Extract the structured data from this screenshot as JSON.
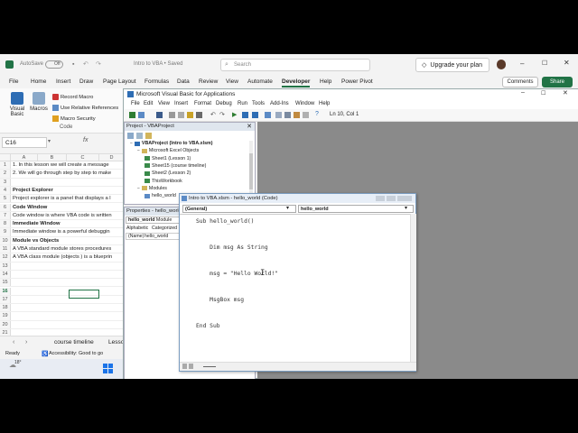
{
  "excel": {
    "autosave_label": "AutoSave",
    "autosave_state": "Off",
    "doc_title": "Intro to VBA • Saved",
    "search_placeholder": "Search",
    "upgrade_label": "Upgrade your plan",
    "menu": [
      "File",
      "Home",
      "Insert",
      "Draw",
      "Page Layout",
      "Formulas",
      "Data",
      "Review",
      "View",
      "Automate",
      "Developer",
      "Help",
      "Power Pivot"
    ],
    "active_menu": "Developer",
    "comments_label": "Comments",
    "share_label": "Share",
    "ribbon": {
      "visual_basic": "Visual Basic",
      "macros": "Macros",
      "record_macro": "Record Macro",
      "relative_refs": "Use Relative References",
      "macro_security": "Macro Security",
      "group_label": "Code"
    },
    "namebox": "C16",
    "fx": "fx",
    "columns": [
      "A",
      "B",
      "C",
      "D"
    ],
    "rows": [
      {
        "num": "1",
        "text": "1. In this lesson we will create a message",
        "bold": false
      },
      {
        "num": "2",
        "text": "2. We will go through step by step to make",
        "bold": false
      },
      {
        "num": "3",
        "text": "",
        "bold": false
      },
      {
        "num": "4",
        "text": "Project Explorer",
        "bold": true
      },
      {
        "num": "5",
        "text": "Project explorer is a panel that displays a l",
        "bold": false
      },
      {
        "num": "6",
        "text": "Code Window",
        "bold": true
      },
      {
        "num": "7",
        "text": "Code window is where VBA code is written",
        "bold": false
      },
      {
        "num": "8",
        "text": "Immediate Window",
        "bold": true
      },
      {
        "num": "9",
        "text": "Immediate window is a powerful debuggin",
        "bold": false
      },
      {
        "num": "10",
        "text": "Module vs Objects",
        "bold": true
      },
      {
        "num": "11",
        "text": "A VBA standard module stores procedures",
        "bold": false
      },
      {
        "num": "12",
        "text": "A VBA class module (objects ) is a blueprin",
        "bold": false
      },
      {
        "num": "13",
        "text": "",
        "bold": false
      },
      {
        "num": "14",
        "text": "",
        "bold": false
      },
      {
        "num": "15",
        "text": "",
        "bold": false
      },
      {
        "num": "16",
        "text": "",
        "bold": false
      },
      {
        "num": "17",
        "text": "",
        "bold": false
      },
      {
        "num": "18",
        "text": "",
        "bold": false
      },
      {
        "num": "19",
        "text": "",
        "bold": false
      },
      {
        "num": "20",
        "text": "",
        "bold": false
      },
      {
        "num": "21",
        "text": "",
        "bold": false
      }
    ],
    "sheet_tab_1": "course timeline",
    "sheet_tab_2": "Lesso",
    "status_ready": "Ready",
    "status_accessibility": "Accessibility: Good to go",
    "weather_temp": "18°"
  },
  "vbe": {
    "title": "Microsoft Visual Basic for Applications",
    "menu": [
      "File",
      "Edit",
      "View",
      "Insert",
      "Format",
      "Debug",
      "Run",
      "Tools",
      "Add-Ins",
      "Window",
      "Help"
    ],
    "cursor_pos": "Ln 10, Col 1",
    "project_title": "Project - VBAProject",
    "tree": [
      {
        "label": "VBAProject (Intro to VBA.xlsm)",
        "level": 0,
        "kind": "project"
      },
      {
        "label": "Microsoft Excel Objects",
        "level": 1,
        "kind": "folder"
      },
      {
        "label": "Sheet1 (Lesson 1)",
        "level": 2,
        "kind": "sheet"
      },
      {
        "label": "Sheet15 (course timeline)",
        "level": 2,
        "kind": "sheet"
      },
      {
        "label": "Sheet2 (Lesson 2)",
        "level": 2,
        "kind": "sheet"
      },
      {
        "label": "ThisWorkbook",
        "level": 2,
        "kind": "workbook"
      },
      {
        "label": "Modules",
        "level": 1,
        "kind": "folder"
      },
      {
        "label": "hello_world",
        "level": 2,
        "kind": "module"
      }
    ],
    "props_title": "Properties - hello_world",
    "props_object": "hello_world",
    "props_object_type": "Module",
    "props_tab_alpha": "Alphabetic",
    "props_tab_cat": "Categorized",
    "props_row_name": "(Name)",
    "props_row_value": "hello_world",
    "code_window_title": "Intro to VBA.xlsm - hello_world (Code)",
    "combo_left": "(General)",
    "combo_right": "hello_world",
    "code": [
      "Sub hello_world()",
      "",
      "    Dim msg As String",
      "",
      "    msg = \"Hello World!\"",
      "",
      "    MsgBox msg",
      "",
      "End Sub",
      ""
    ]
  }
}
